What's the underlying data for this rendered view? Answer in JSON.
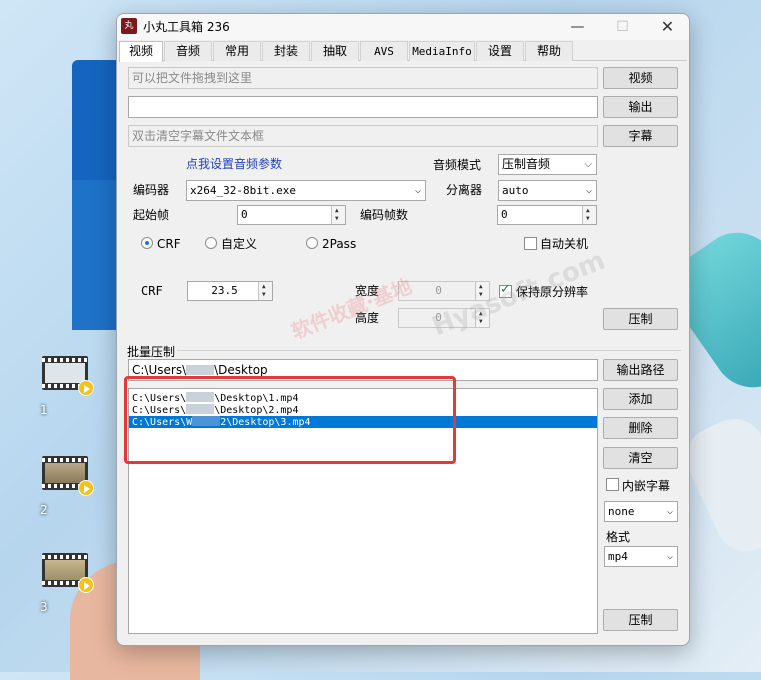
{
  "window": {
    "app_icon": "丸",
    "title": "小丸工具箱 236",
    "min_glyph": "—",
    "max_glyph": "☐",
    "close_glyph": "✕"
  },
  "tabs": [
    {
      "label": "视频",
      "active": true
    },
    {
      "label": "音频"
    },
    {
      "label": "常用"
    },
    {
      "label": "封装"
    },
    {
      "label": "抽取"
    },
    {
      "label": "AVS"
    },
    {
      "label": "MediaInfo"
    },
    {
      "label": "设置"
    },
    {
      "label": "帮助"
    }
  ],
  "video": {
    "drag_placeholder": "可以把文件拖拽到这里",
    "video_button": "视频",
    "output_value": "",
    "output_button": "输出",
    "subtitle_placeholder": "双击清空字幕文件文本框",
    "subtitle_button": "字幕",
    "audio_settings_link": "点我设置音频参数",
    "audio_mode_label": "音频模式",
    "audio_mode_value": "压制音频",
    "encoder_label": "编码器",
    "encoder_value": "x264_32-8bit.exe",
    "demuxer_label": "分离器",
    "demuxer_value": "auto",
    "start_frame_label": "起始帧",
    "start_frame_value": "0",
    "frame_count_label": "编码帧数",
    "frame_count_value": "0",
    "rate_modes": [
      {
        "label": "CRF",
        "selected": true
      },
      {
        "label": "自定义",
        "selected": false
      },
      {
        "label": "2Pass",
        "selected": false
      }
    ],
    "auto_shutdown_label": "自动关机",
    "crf_label": "CRF",
    "crf_value": "23.5",
    "width_label": "宽度",
    "width_value": "0",
    "height_label": "高度",
    "height_value": "0",
    "keep_res_label": "保持原分辨率",
    "encode_button": "压制"
  },
  "batch": {
    "group_title": "批量压制",
    "path_prefix": "C:\\Users\\",
    "path_suffix": "\\Desktop",
    "output_path_button": "输出路径",
    "files": [
      {
        "prefix": "C:\\Users\\",
        "suffix": "\\Desktop\\1.mp4",
        "selected": false
      },
      {
        "prefix": "C:\\Users\\",
        "suffix": "\\Desktop\\2.mp4",
        "selected": false
      },
      {
        "prefix": "C:\\Users\\W",
        "suffix": "2\\Desktop\\3.mp4",
        "selected": true
      }
    ],
    "add_button": "添加",
    "delete_button": "删除",
    "clear_button": "清空",
    "embed_sub_label": "内嵌字幕",
    "sub_select_value": "none",
    "format_label": "格式",
    "format_value": "mp4",
    "encode_button": "压制"
  },
  "desktop_icons": [
    {
      "label": "1"
    },
    {
      "label": "2"
    },
    {
      "label": "3"
    }
  ],
  "watermark": {
    "cn": "软件收藏·基地",
    "en": "Hyasoft.com"
  }
}
